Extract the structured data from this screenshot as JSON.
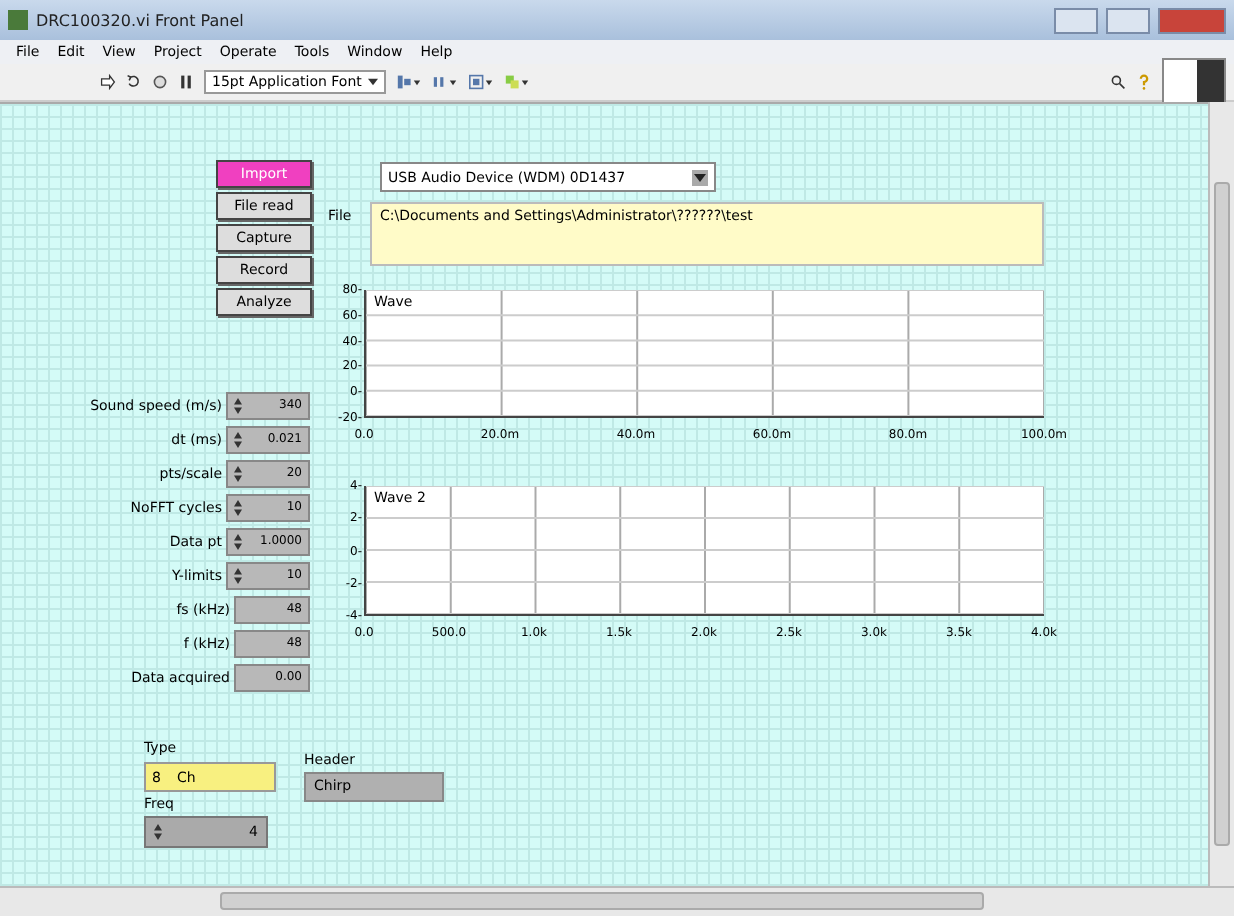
{
  "window": {
    "title": "DRC100320.vi Front Panel"
  },
  "menu": [
    "File",
    "Edit",
    "View",
    "Project",
    "Operate",
    "Tools",
    "Window",
    "Help"
  ],
  "toolbar": {
    "font": "15pt Application Font"
  },
  "buttons": [
    {
      "label": "Import",
      "selected": true
    },
    {
      "label": "File read",
      "selected": false
    },
    {
      "label": "Capture",
      "selected": false
    },
    {
      "label": "Record",
      "selected": false
    },
    {
      "label": "Analyze",
      "selected": false
    }
  ],
  "device": {
    "value": "USB Audio Device (WDM) 0D1437"
  },
  "file": {
    "label": "File",
    "value": "C:\\Documents and Settings\\Administrator\\??????\\test"
  },
  "numerics": [
    {
      "label": "Sound speed (m/s)",
      "value": "340",
      "kind": "control"
    },
    {
      "label": "dt (ms)",
      "value": "0.021",
      "kind": "control"
    },
    {
      "label": "pts/scale",
      "value": "20",
      "kind": "control"
    },
    {
      "label": "NoFFT cycles",
      "value": "10",
      "kind": "control"
    },
    {
      "label": "Data pt",
      "value": "1.0000",
      "kind": "control"
    },
    {
      "label": "Y-limits",
      "value": "10",
      "kind": "control"
    },
    {
      "label": "fs (kHz)",
      "value": "48",
      "kind": "indicator"
    },
    {
      "label": "f (kHz)",
      "value": "48",
      "kind": "indicator"
    },
    {
      "label": "Data acquired",
      "value": "0.00",
      "kind": "indicator"
    }
  ],
  "charts": [
    {
      "chart_data": {
        "type": "line",
        "title": "Wave",
        "xlim": [
          0,
          100
        ],
        "ylim": [
          -20,
          80
        ],
        "grid": true,
        "xticks": [
          {
            "value": 0,
            "label": "0.0"
          },
          {
            "value": 20,
            "label": "20.0m"
          },
          {
            "value": 40,
            "label": "40.0m"
          },
          {
            "value": 60,
            "label": "60.0m"
          },
          {
            "value": 80,
            "label": "80.0m"
          },
          {
            "value": 100,
            "label": "100.0m"
          }
        ],
        "yticks": [
          {
            "value": 80,
            "label": "80-"
          },
          {
            "value": 60,
            "label": "60-"
          },
          {
            "value": 40,
            "label": "40-"
          },
          {
            "value": 20,
            "label": "20-"
          },
          {
            "value": 0,
            "label": "0-"
          },
          {
            "value": -20,
            "label": "-20-"
          }
        ]
      }
    },
    {
      "chart_data": {
        "type": "line",
        "title": "Wave 2",
        "xlim": [
          0,
          4000
        ],
        "ylim": [
          -4,
          4
        ],
        "grid": true,
        "xticks": [
          {
            "value": 0,
            "label": "0.0"
          },
          {
            "value": 500,
            "label": "500.0"
          },
          {
            "value": 1000,
            "label": "1.0k"
          },
          {
            "value": 1500,
            "label": "1.5k"
          },
          {
            "value": 2000,
            "label": "2.0k"
          },
          {
            "value": 2500,
            "label": "2.5k"
          },
          {
            "value": 3000,
            "label": "3.0k"
          },
          {
            "value": 3500,
            "label": "3.5k"
          },
          {
            "value": 4000,
            "label": "4.0k"
          }
        ],
        "yticks": [
          {
            "value": 4,
            "label": "4-"
          },
          {
            "value": 2,
            "label": "2-"
          },
          {
            "value": 0,
            "label": "0-"
          },
          {
            "value": -2,
            "label": "-2-"
          },
          {
            "value": -4,
            "label": "-4-"
          }
        ]
      }
    }
  ],
  "type": {
    "label": "Type",
    "prefix": "8",
    "value": "Ch"
  },
  "freq": {
    "label": "Freq",
    "value": "4"
  },
  "header": {
    "label": "Header",
    "value": "Chirp"
  }
}
